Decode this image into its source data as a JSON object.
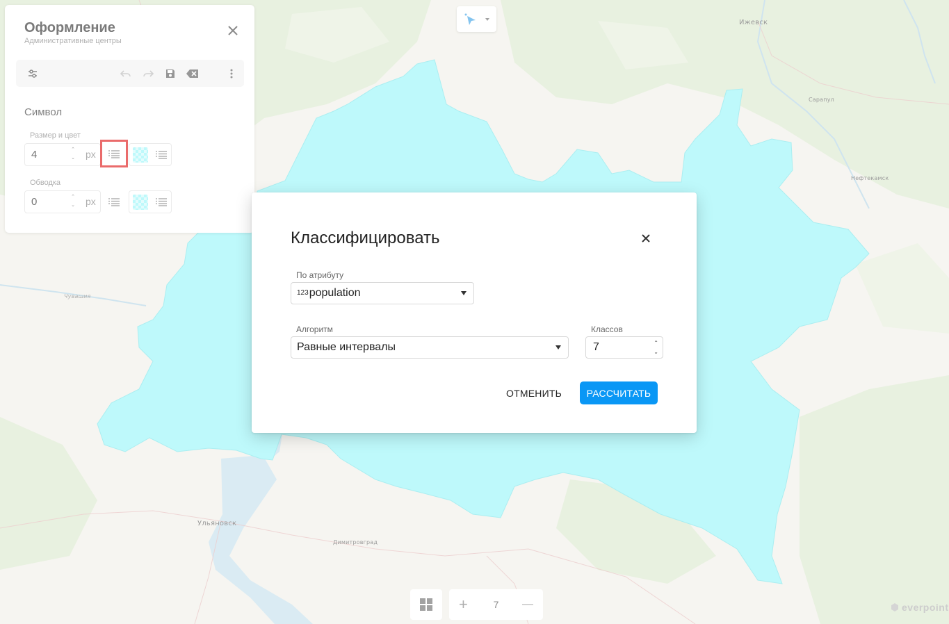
{
  "map": {
    "region_color": "#9ff7fa",
    "cities": [
      {
        "name": "Ижевск",
        "style": "normal"
      },
      {
        "name": "Сарапул",
        "style": "small"
      },
      {
        "name": "Нефтекамск",
        "style": "small"
      },
      {
        "name": "Ульяновск",
        "style": "normal"
      },
      {
        "name": "Димитровград",
        "style": "small"
      },
      {
        "name": "Чувашия",
        "style": "italic"
      }
    ]
  },
  "panel": {
    "title": "Оформление",
    "subtitle": "Административные центры",
    "symbol_heading": "Символ",
    "size_color_label": "Размер и цвет",
    "size_value": "4",
    "size_unit": "px",
    "stroke_label": "Обводка",
    "stroke_value": "0",
    "stroke_unit": "px",
    "fill_color": "#9ff7fa"
  },
  "toolbar": {
    "icons": [
      "settings-sliders-icon",
      "undo-icon",
      "redo-icon",
      "save-icon",
      "clear-icon",
      "more-vertical-icon"
    ]
  },
  "mode_control": {
    "icon": "pointer-icon"
  },
  "zoom": {
    "level": "7",
    "plus": "+",
    "minus": "—"
  },
  "brand": {
    "name": "everpoint"
  },
  "dialog": {
    "title": "Классифицировать",
    "attribute_label": "По атрибуту",
    "attribute_type": "123",
    "attribute_value": "population",
    "algorithm_label": "Алгоритм",
    "algorithm_value": "Равные интервалы",
    "classes_label": "Классов",
    "classes_value": "7",
    "cancel_label": "ОТМЕНИТЬ",
    "calculate_label": "РАССЧИТАТЬ",
    "accent_color": "#0a97f5"
  }
}
